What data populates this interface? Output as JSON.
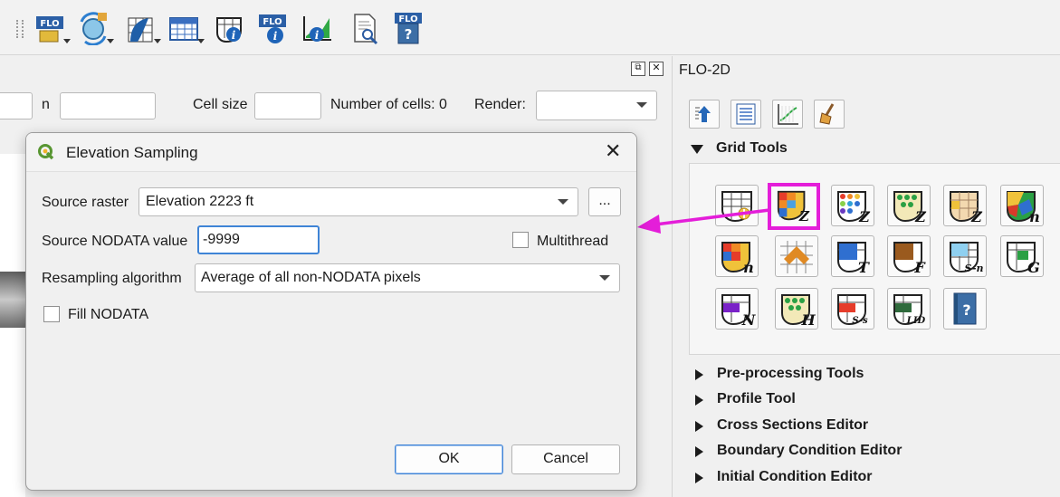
{
  "gridbar": {
    "n_label": "n",
    "cell_size_label": "Cell size",
    "cells_label": "Number of cells: 0",
    "render_label": "Render:"
  },
  "dock": {
    "title": "FLO-2D",
    "grid_tools_title": "Grid Tools",
    "sections": [
      "Pre-processing Tools",
      "Profile Tool",
      "Cross Sections Editor",
      "Boundary Condition Editor",
      "Initial Condition Editor"
    ],
    "grid_tool_letters": [
      "Z",
      "Z",
      "Z",
      "Z",
      "n",
      "n",
      "T",
      "F",
      "S-n",
      "G",
      "N",
      "H",
      "S-s",
      "LID"
    ]
  },
  "dialog": {
    "title": "Elevation Sampling",
    "source_raster_label": "Source raster",
    "source_raster_value": "Elevation 2223 ft",
    "browse_label": "...",
    "nodata_label": "Source NODATA value",
    "nodata_value": "-9999",
    "multithread_label": "Multithread",
    "resampling_label": "Resampling algorithm",
    "resampling_value": "Average of all non-NODATA pixels",
    "fill_nodata_label": "Fill NODATA",
    "ok_label": "OK",
    "cancel_label": "Cancel"
  },
  "colors": {
    "highlight": "#e41ed9",
    "focus_blue": "#3f84d6",
    "qgis_green": "#589632"
  }
}
